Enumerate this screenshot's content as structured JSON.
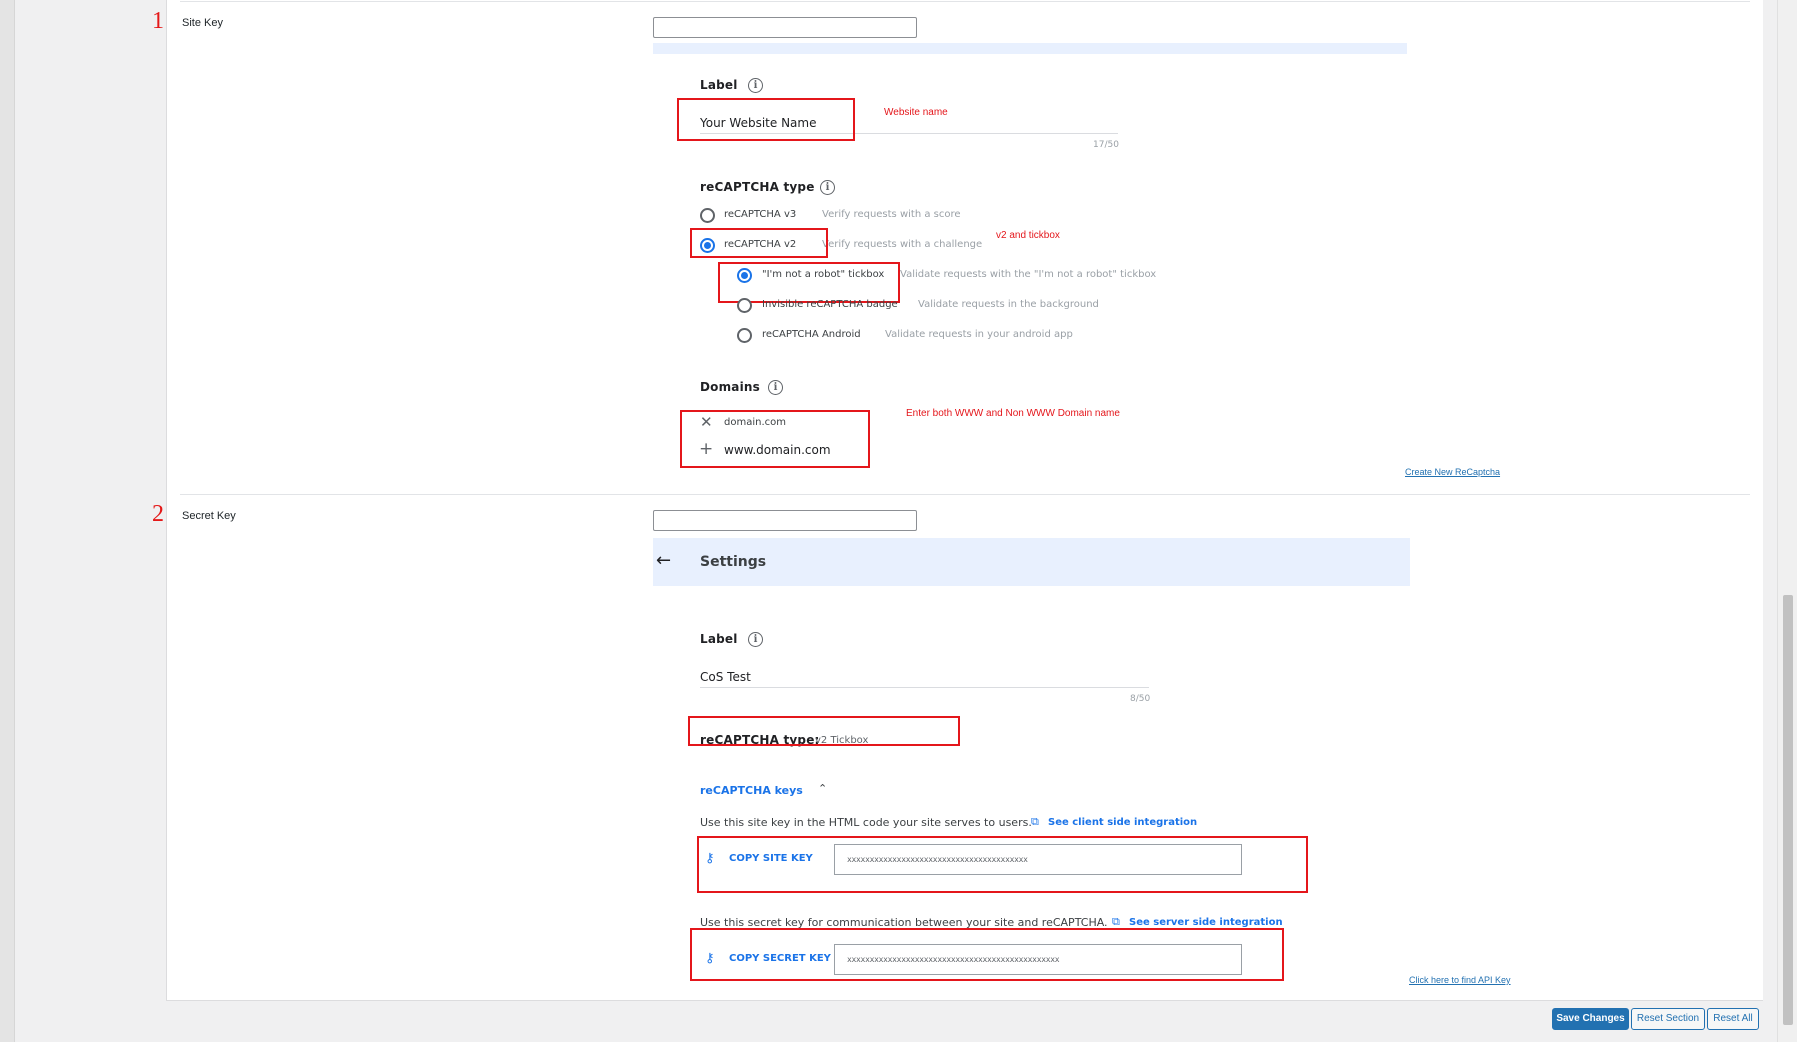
{
  "rows": {
    "site_key": {
      "number": "1",
      "label": "Site Key"
    },
    "secret_key": {
      "number": "2",
      "label": "Secret Key"
    }
  },
  "register_form": {
    "label_heading": "Label",
    "label_value": "Your Website Name",
    "label_counter": "17/50",
    "type_heading": "reCAPTCHA type",
    "types": [
      {
        "label": "reCAPTCHA v3",
        "hint": "Verify requests with a score"
      },
      {
        "label": "reCAPTCHA v2",
        "hint": "Verify requests with a challenge"
      }
    ],
    "subtypes": [
      {
        "label": "\"I'm not a robot\" tickbox",
        "hint": "Validate requests with the \"I'm not a robot\" tickbox"
      },
      {
        "label": "Invisible reCAPTCHA badge",
        "hint": "Validate requests in the background"
      },
      {
        "label": "reCAPTCHA Android",
        "hint": "Validate requests in your android app"
      }
    ],
    "domains_heading": "Domains",
    "domain_1": "domain.com",
    "domain_2": "www.domain.com"
  },
  "annotations": {
    "website_name": "Website name",
    "v2_tickbox": "v2 and tickbox",
    "domains": "Enter both WWW and Non WWW Domain name"
  },
  "links": {
    "create_new": "Create New ReCaptcha",
    "find_api_key": "Click here to find API Key"
  },
  "settings_form": {
    "back_icon": "arrow-left-icon",
    "title": "Settings",
    "label_heading": "Label",
    "label_value": "CoS Test",
    "label_counter": "8/50",
    "type_heading": "reCAPTCHA type:",
    "type_value": "v2 Tickbox",
    "keys_heading": "reCAPTCHA keys",
    "site_key_desc": "Use this site key in the HTML code your site serves to users.",
    "site_key_link": "See client side integration",
    "copy_site_key": "COPY SITE KEY",
    "site_key_value": "xxxxxxxxxxxxxxxxxxxxxxxxxxxxxxxxxxxxxxxx",
    "secret_key_desc": "Use this secret key for communication between your site and reCAPTCHA.",
    "secret_key_link": "See server side integration",
    "copy_secret_key": "COPY SECRET KEY",
    "secret_key_value": "xxxxxxxxxxxxxxxxxxxxxxxxxxxxxxxxxxxxxxxxxxxxxxx"
  },
  "buttons": {
    "save": "Save Changes",
    "reset_section": "Reset Section",
    "reset_all": "Reset All"
  },
  "colors": {
    "annotation": "#e4161b",
    "google_blue": "#1a73e8",
    "wp_blue": "#2271b1"
  }
}
